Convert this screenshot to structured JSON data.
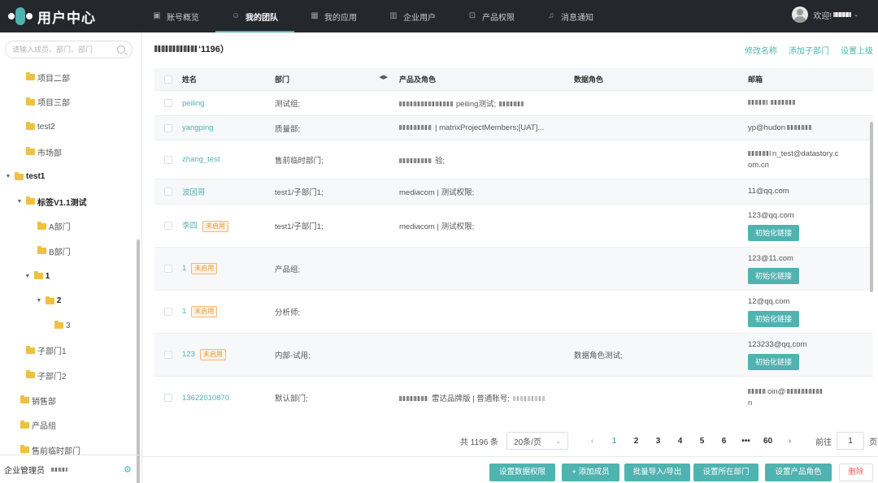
{
  "app": {
    "logo_text": "用户中心"
  },
  "nav": [
    {
      "label": "账号概览",
      "icon": "user-card-icon"
    },
    {
      "label": "我的团队",
      "icon": "team-icon",
      "active": true
    },
    {
      "label": "我的应用",
      "icon": "grid-icon"
    },
    {
      "label": "企业用户",
      "icon": "building-icon"
    },
    {
      "label": "产品权限",
      "icon": "lock-icon"
    },
    {
      "label": "消息通知",
      "icon": "bell-icon"
    }
  ],
  "user": {
    "greeting": "欢迎!"
  },
  "sidebar": {
    "search_placeholder": "请输入成员、部门、部门",
    "tree": [
      {
        "label": "项目二部",
        "level": 1,
        "bold": false,
        "caret": ""
      },
      {
        "label": "项目三部",
        "level": 1,
        "bold": false,
        "caret": ""
      },
      {
        "label": "test2",
        "level": 1,
        "bold": false,
        "caret": ""
      },
      {
        "label": "市场部",
        "level": 1,
        "bold": false,
        "caret": ""
      },
      {
        "label": "test1",
        "level": 0,
        "bold": true,
        "caret": "▼"
      },
      {
        "label": "标签V1.1测试",
        "level": 1,
        "bold": true,
        "caret": "▼"
      },
      {
        "label": "A部门",
        "level": 2,
        "bold": false,
        "caret": ""
      },
      {
        "label": "B部门",
        "level": 2,
        "bold": false,
        "caret": ""
      },
      {
        "label": "1",
        "level": 1.7,
        "bold": true,
        "caret": "▼"
      },
      {
        "label": "2",
        "level": 2.7,
        "bold": true,
        "caret": "▼"
      },
      {
        "label": "3",
        "level": 3.5,
        "bold": false,
        "caret": ""
      },
      {
        "label": "子部门1",
        "level": 1,
        "bold": false,
        "caret": ""
      },
      {
        "label": "子部门2",
        "level": 1,
        "bold": false,
        "caret": ""
      },
      {
        "label": "销售部",
        "level": 0.5,
        "bold": false,
        "caret": ""
      },
      {
        "label": "产品组",
        "level": 0.5,
        "bold": false,
        "caret": ""
      },
      {
        "label": "售前临时部门",
        "level": 0.5,
        "bold": false,
        "caret": ""
      }
    ],
    "footer_label": "企业管理员"
  },
  "main": {
    "title_count": "‘1196）",
    "actions": [
      "修改名称",
      "添加子部门",
      "设置上级"
    ],
    "columns": {
      "name": "姓名",
      "dept": "部门",
      "product": "产品及角色",
      "data_role": "数据角色",
      "email": "邮箱"
    },
    "rows": [
      {
        "name": "peiling",
        "badge": "",
        "dept": "测试组;",
        "product": "peiling测试;",
        "data_role": "",
        "email": "",
        "email2": "",
        "button": ""
      },
      {
        "name": "yangping",
        "badge": "",
        "dept": "质量部;",
        "product": "| matrixProjectMembers;[UAT]...",
        "data_role": "",
        "email": "yp@hudon",
        "email2": "",
        "button": ""
      },
      {
        "name": "zhang_test",
        "badge": "",
        "dept": "售前临时部门;",
        "product": "验;",
        "data_role": "",
        "email": "n_test@datastory.c",
        "email2": "om.cn",
        "button": ""
      },
      {
        "name": "波因哥",
        "badge": "",
        "dept": "test1/子部门1;",
        "product": "mediacom | 测试权限;",
        "data_role": "",
        "email": "11@qq.com",
        "email2": "",
        "button": ""
      },
      {
        "name": "李四",
        "badge": "未启用",
        "dept": "test1/子部门1;",
        "product": "mediacom | 测试权限;",
        "data_role": "",
        "email": "123@qq.com",
        "email2": "",
        "button": "初始化链接"
      },
      {
        "name": "1",
        "badge": "未启用",
        "dept": "产品组;",
        "product": "",
        "data_role": "",
        "email": "123@11.com",
        "email2": "",
        "button": "初始化链接"
      },
      {
        "name": "1",
        "badge": "未启用",
        "dept": "分析师;",
        "product": "",
        "data_role": "",
        "email": "12@qq.com",
        "email2": "",
        "button": "初始化链接"
      },
      {
        "name": "123",
        "badge": "未启用",
        "dept": "内部-试用;",
        "product": "",
        "data_role": "数据角色测试;",
        "email": "123233@qq.com",
        "email2": "",
        "button": "初始化链接"
      },
      {
        "name": "13622010870",
        "badge": "",
        "dept": "默认部门;",
        "product": "雷达品牌版 | 普通账号;",
        "data_role": "",
        "email": "oin@",
        "email2": "n",
        "button": ""
      }
    ]
  },
  "pager": {
    "total": "共 1196 条",
    "page_size": "20条/页",
    "pages": [
      "1",
      "2",
      "3",
      "4",
      "5",
      "6",
      "•••",
      "60"
    ],
    "current": "1",
    "jump_prefix": "前往",
    "jump_value": "1",
    "jump_suffix": "页"
  },
  "toolbar": {
    "buttons": [
      "设置数据权限",
      "+ 添加成员",
      "批量导入/导出",
      "设置所在部门",
      "设置产品角色",
      "删除"
    ]
  }
}
